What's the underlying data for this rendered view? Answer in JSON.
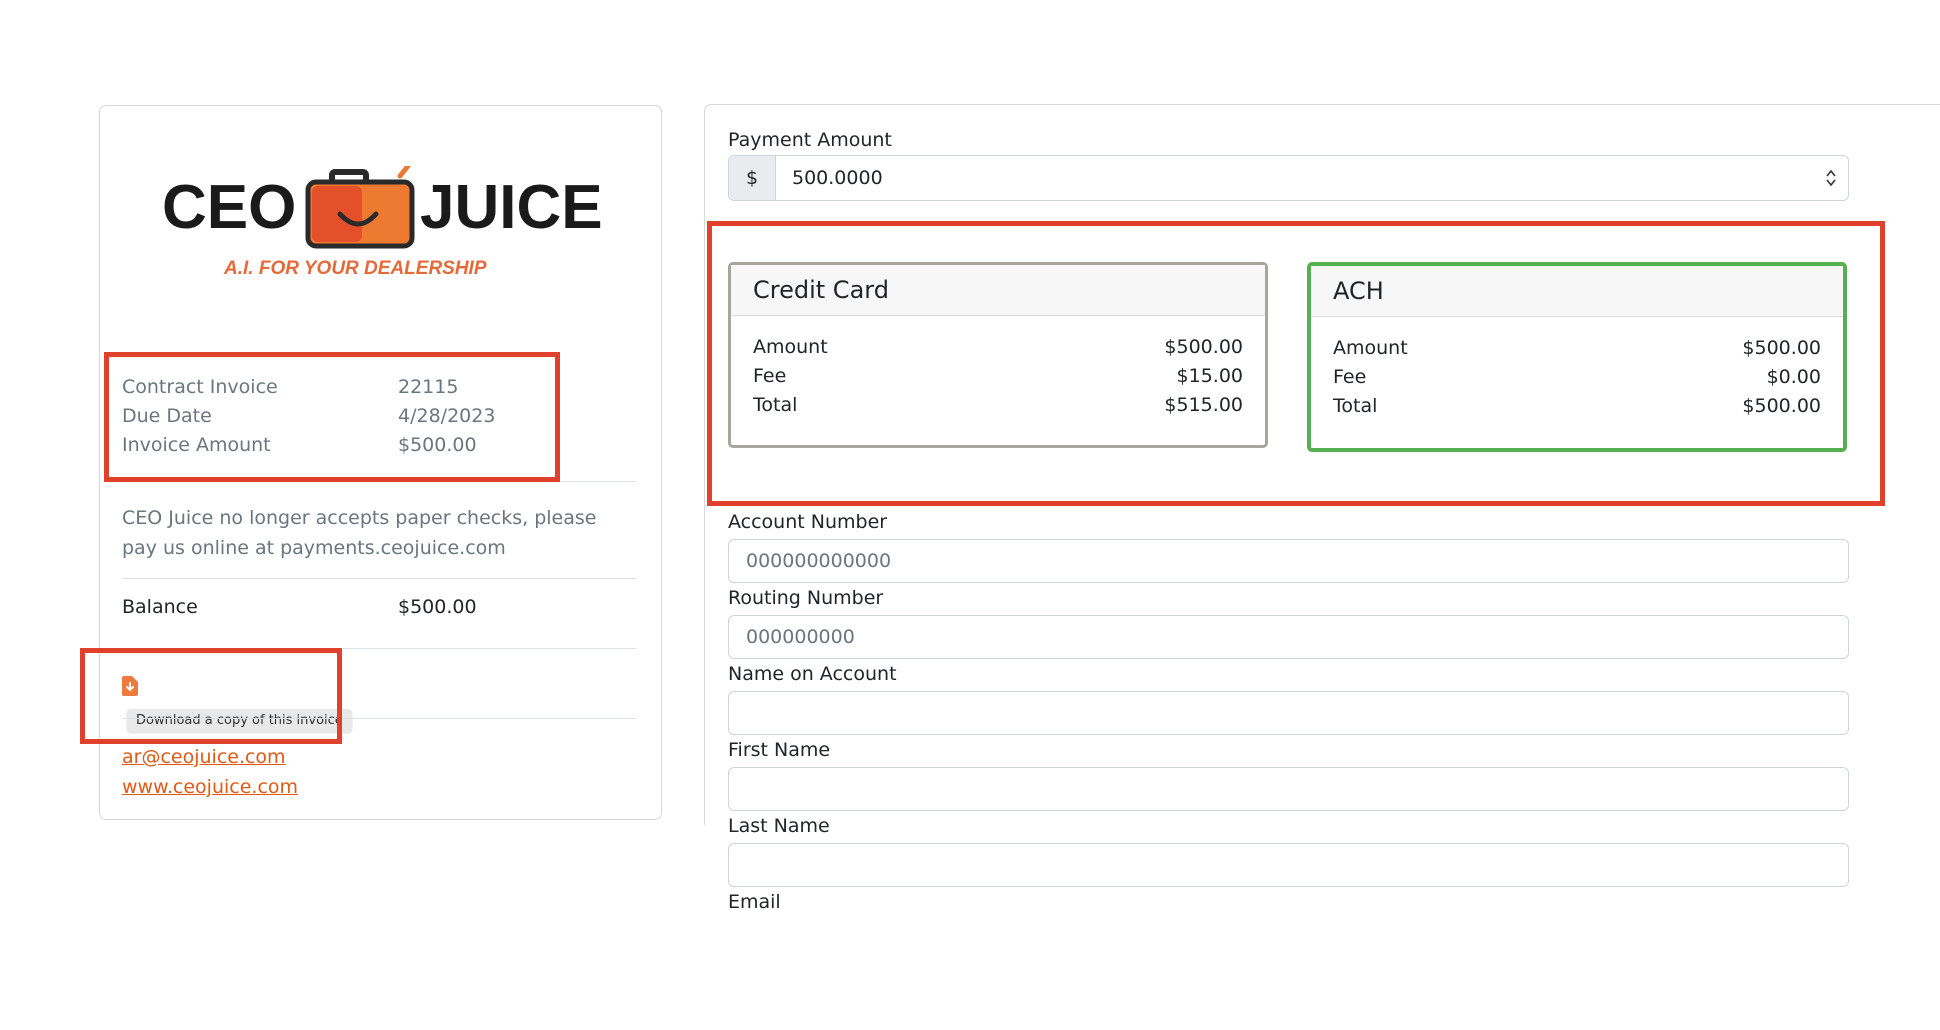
{
  "brand": {
    "logo_left": "CEO",
    "logo_right": "JUICE",
    "tagline": "A.I. FOR YOUR DEALERSHIP",
    "colors": {
      "accent": "#e05a16",
      "case_orange": "#f2973a",
      "case_red": "#e4502a"
    }
  },
  "invoice": {
    "rows": [
      {
        "label": "Contract Invoice",
        "value": "22115"
      },
      {
        "label": "Due Date",
        "value": "4/28/2023"
      },
      {
        "label": "Invoice Amount",
        "value": "$500.00"
      }
    ],
    "notice": "CEO Juice no longer accepts paper checks, please pay us online at payments.ceojuice.com",
    "balance_label": "Balance",
    "balance_value": "$500.00",
    "download_tooltip": "Download a copy of this invoice",
    "download_icon": "file-download-icon",
    "email": "ar@ceojuice.com",
    "website": "www.ceojuice.com"
  },
  "payment": {
    "amount_label": "Payment Amount",
    "currency_symbol": "$",
    "amount_value": "500.0000",
    "options": [
      {
        "title": "Credit Card",
        "rows": [
          {
            "label": "Amount",
            "value": "$500.00"
          },
          {
            "label": "Fee",
            "value": "$15.00"
          },
          {
            "label": "Total",
            "value": "$515.00"
          }
        ]
      },
      {
        "title": "ACH",
        "selected": true,
        "rows": [
          {
            "label": "Amount",
            "value": "$500.00"
          },
          {
            "label": "Fee",
            "value": "$0.00"
          },
          {
            "label": "Total",
            "value": "$500.00"
          }
        ]
      }
    ],
    "fields": {
      "account_number": {
        "label": "Account Number",
        "placeholder": "000000000000"
      },
      "routing_number": {
        "label": "Routing Number",
        "placeholder": "000000000"
      },
      "name_on_account": {
        "label": "Name on Account",
        "placeholder": ""
      },
      "first_name": {
        "label": "First Name",
        "placeholder": ""
      },
      "last_name": {
        "label": "Last Name",
        "placeholder": ""
      },
      "email": {
        "label": "Email"
      }
    }
  },
  "annotation_colors": {
    "red_box": "#e0412c",
    "green_box": "#55b04f"
  }
}
